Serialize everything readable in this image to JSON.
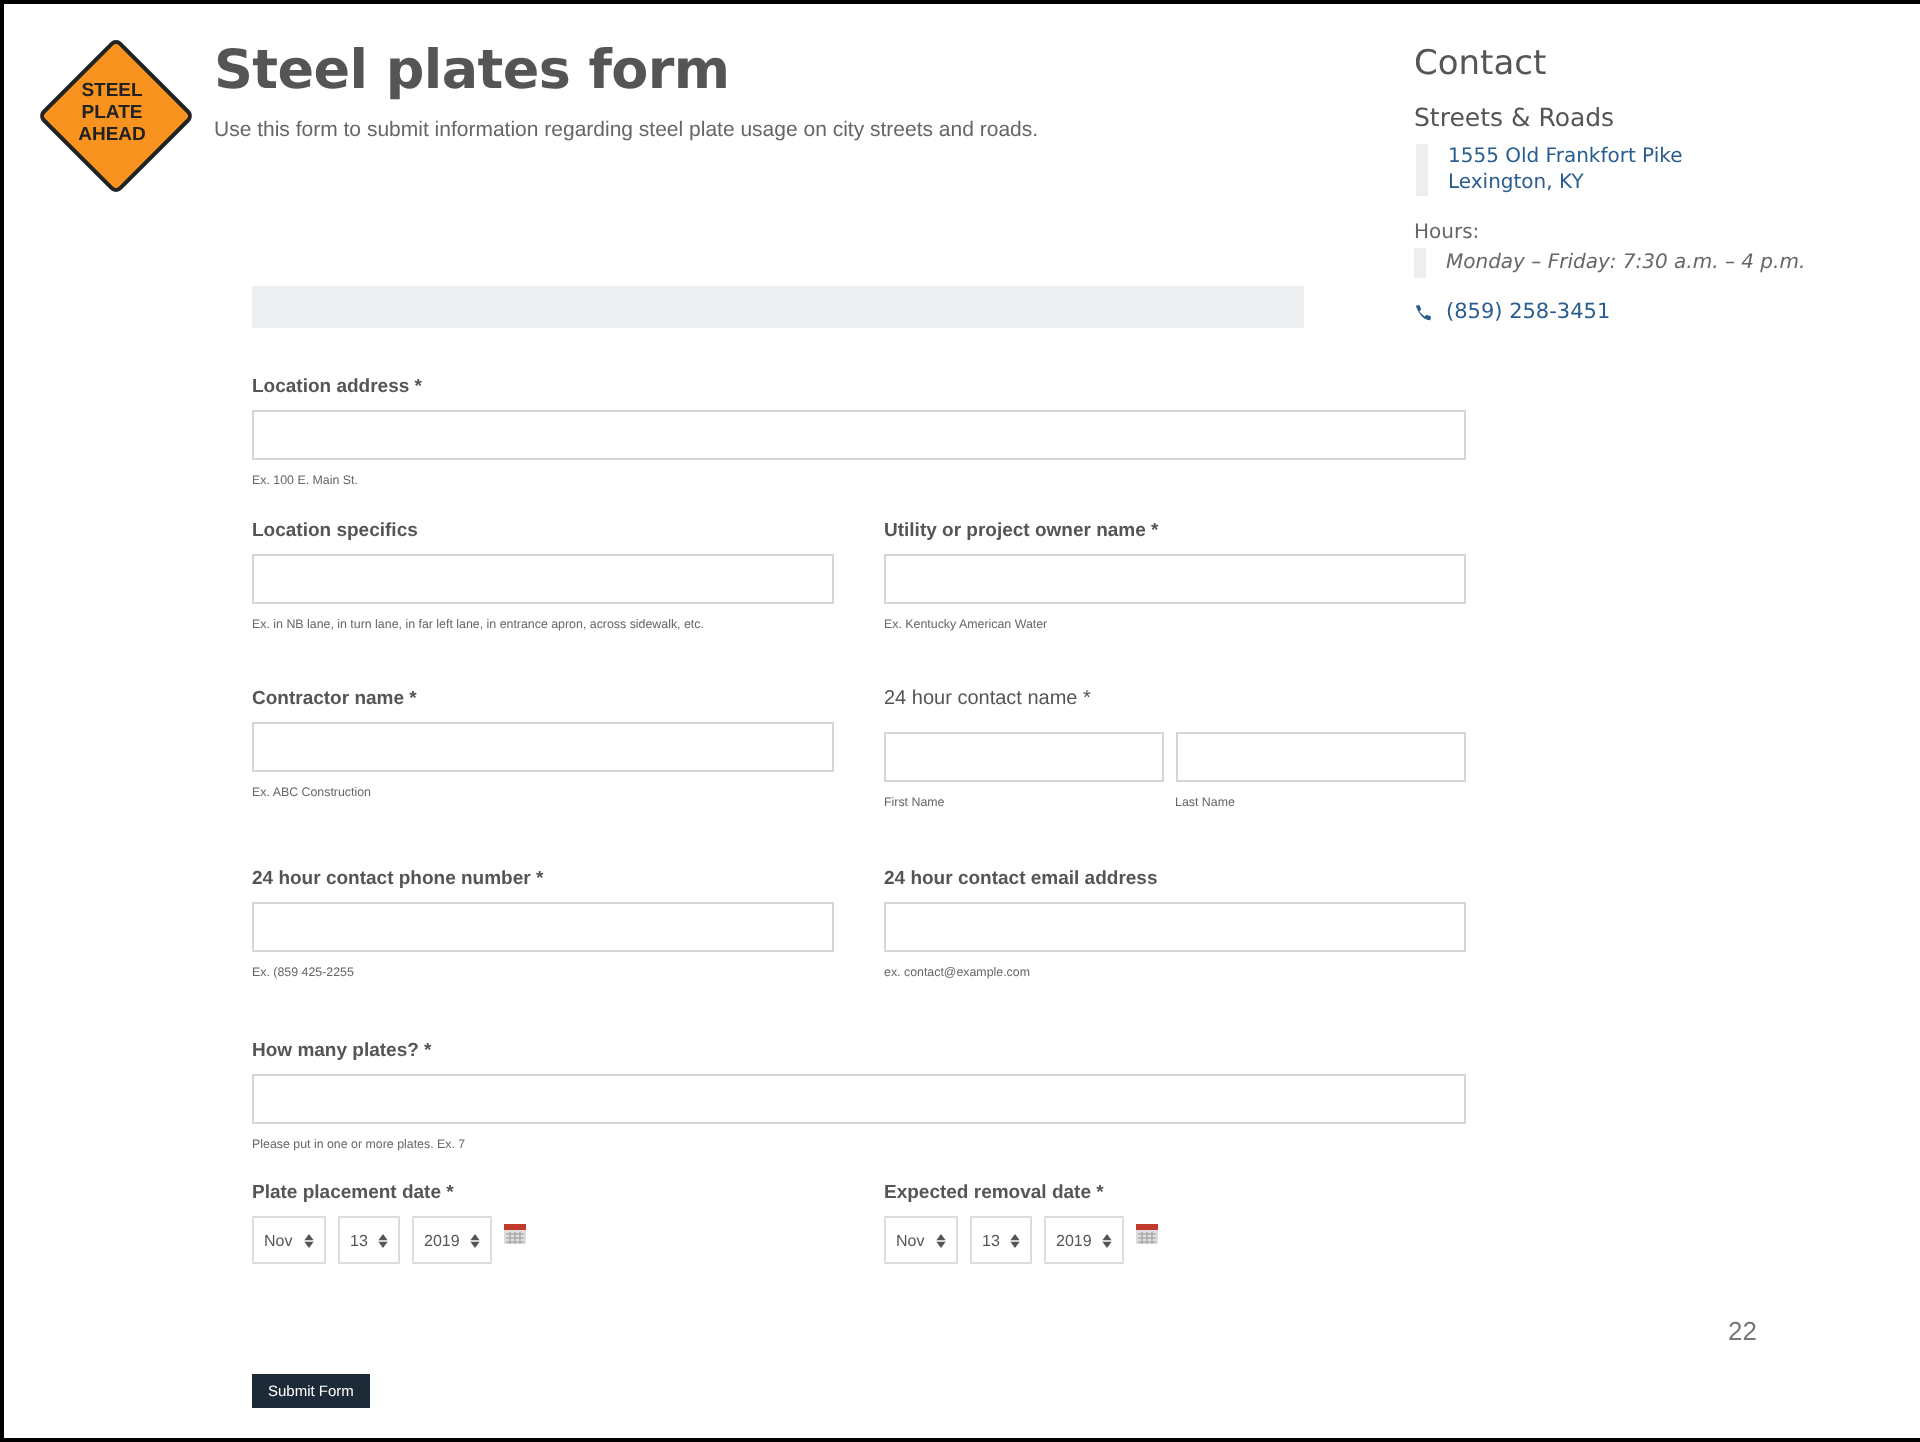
{
  "sign": {
    "lines": [
      "STEEL",
      "PLATE",
      "AHEAD"
    ]
  },
  "header": {
    "title": "Steel plates form",
    "description": "Use this form to submit information regarding steel plate usage on city streets and roads."
  },
  "contact": {
    "heading": "Contact",
    "department": "Streets & Roads",
    "address_lines": [
      "1555 Old Frankfort Pike",
      "Lexington, KY"
    ],
    "hours_label": "Hours:",
    "hours": "Monday – Friday: 7:30 a.m. – 4 p.m.",
    "phone": "(859) 258-3451"
  },
  "form": {
    "rows": [
      [
        {
          "kind": "text",
          "label": "Location address *",
          "hint": "Ex. 100 E. Main St.",
          "wide": true
        }
      ],
      [
        {
          "kind": "text",
          "label": "Location specifics",
          "hint": "Ex. in NB lane, in turn lane, in far left lane, in entrance apron, across sidewalk, etc."
        },
        {
          "kind": "text",
          "label": "Utility or project owner name *",
          "hint": "Ex. Kentucky American Water"
        }
      ],
      [
        {
          "kind": "text",
          "label": "Contractor name *",
          "hint": "Ex. ABC Construction"
        },
        {
          "kind": "name",
          "label": "24 hour contact name *",
          "sublabels": [
            "First Name",
            "Last Name"
          ]
        }
      ],
      [
        {
          "kind": "text",
          "label": "24 hour contact phone number *",
          "hint": "Ex. (859 425-2255"
        },
        {
          "kind": "text",
          "label": "24 hour contact email address",
          "hint": "ex. contact@example.com"
        }
      ],
      [
        {
          "kind": "text",
          "label": "How many plates? *",
          "hint": "Please put in one or more plates. Ex. 7",
          "wide": true
        }
      ],
      [
        {
          "kind": "date",
          "label": "Plate placement date *",
          "month": "Nov",
          "day": "13",
          "year": "2019"
        },
        {
          "kind": "date",
          "label": "Expected removal date *",
          "month": "Nov",
          "day": "13",
          "year": "2019"
        }
      ]
    ],
    "submit": "Submit Form"
  },
  "page_number": "22"
}
